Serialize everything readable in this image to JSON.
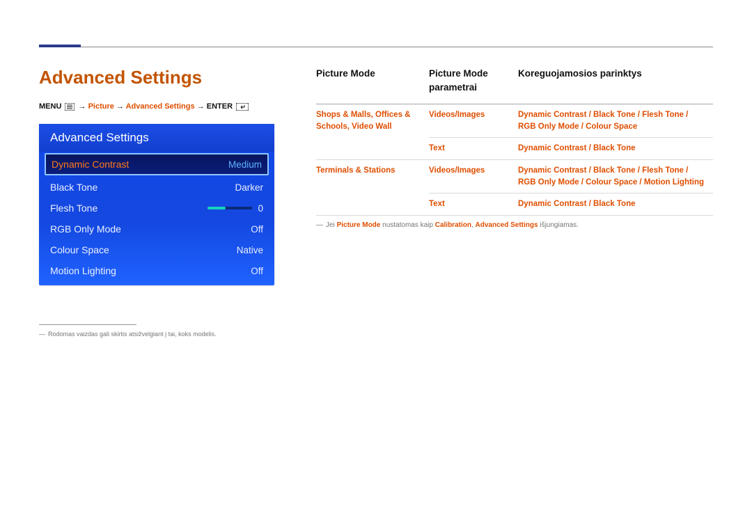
{
  "page_title": "Advanced Settings",
  "breadcrumb": {
    "menu": "MENU",
    "arrow": "→",
    "picture": "Picture",
    "advanced": "Advanced Settings",
    "enter": "ENTER"
  },
  "osd": {
    "title": "Advanced Settings",
    "rows": [
      {
        "label": "Dynamic Contrast",
        "value": "Medium",
        "selected": true
      },
      {
        "label": "Black Tone",
        "value": "Darker"
      },
      {
        "label": "Flesh Tone",
        "value": "0",
        "slider": true
      },
      {
        "label": "RGB Only Mode",
        "value": "Off"
      },
      {
        "label": "Colour Space",
        "value": "Native"
      },
      {
        "label": "Motion Lighting",
        "value": "Off"
      }
    ]
  },
  "footnote_left": "Rodomas vaizdas gali skirtis atsižvelgiant į tai, koks modelis.",
  "table": {
    "headers": [
      "Picture Mode",
      "Picture Mode parametrai",
      "Koreguojamosios parinktys"
    ],
    "rows": [
      {
        "c1": "Shops & Malls, Offices & Schools, Video Wall",
        "c2": "Videos/Images",
        "c3": "Dynamic Contrast / Black Tone / Flesh Tone / RGB Only Mode / Colour Space"
      },
      {
        "c1": "",
        "c2": "Text",
        "c3": "Dynamic Contrast / Black Tone"
      },
      {
        "c1": "Terminals & Stations",
        "c2": "Videos/Images",
        "c3": "Dynamic Contrast / Black Tone / Flesh Tone / RGB Only Mode / Colour Space / Motion Lighting"
      },
      {
        "c1": "",
        "c2": "Text",
        "c3": "Dynamic Contrast / Black Tone"
      }
    ],
    "footnote": {
      "pre": "Jei ",
      "b1": "Picture Mode",
      "mid": " nustatomas kaip ",
      "b2": "Calibration",
      "sep": ", ",
      "b3": "Advanced Settings",
      "post": " išjungiamas."
    }
  }
}
